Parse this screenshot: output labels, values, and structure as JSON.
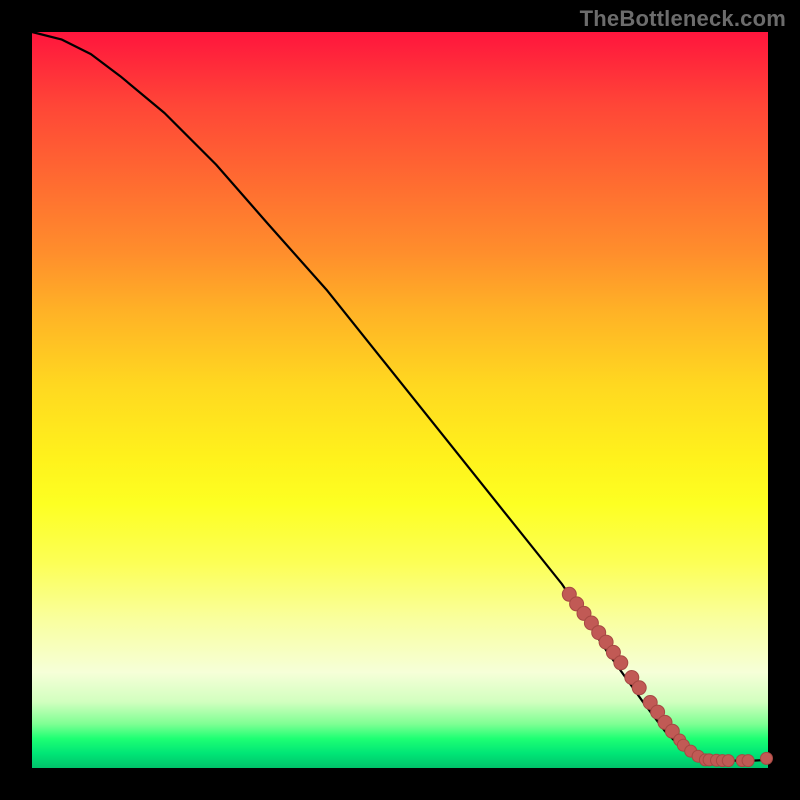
{
  "watermark": "TheBottleneck.com",
  "chart_data": {
    "type": "line",
    "title": "",
    "xlabel": "",
    "ylabel": "",
    "xlim": [
      0,
      100
    ],
    "ylim": [
      0,
      100
    ],
    "series": [
      {
        "name": "bottleneck-curve",
        "x": [
          0,
          4,
          8,
          12,
          18,
          25,
          32,
          40,
          48,
          56,
          64,
          72,
          78,
          83,
          86,
          88,
          90,
          92,
          95,
          98,
          100
        ],
        "y": [
          100,
          99,
          97,
          94,
          89,
          82,
          74,
          65,
          55,
          45,
          35,
          25,
          16,
          9,
          5,
          3,
          1.8,
          1.2,
          1.0,
          1.0,
          1.1
        ]
      }
    ],
    "points": {
      "name": "data-markers",
      "x": [
        73.0,
        74.0,
        75.0,
        76.0,
        77.0,
        78.0,
        79.0,
        80.0,
        81.5,
        82.5,
        84.0,
        85.0,
        86.0,
        87.0,
        88.0,
        88.5,
        89.5,
        90.5,
        91.5,
        92.0,
        93.0,
        93.8,
        94.6,
        96.5,
        97.3,
        99.8
      ],
      "y": [
        23.6,
        22.3,
        21.0,
        19.7,
        18.4,
        17.1,
        15.7,
        14.3,
        12.3,
        10.9,
        8.9,
        7.6,
        6.2,
        5.0,
        3.8,
        3.1,
        2.3,
        1.6,
        1.1,
        1.1,
        1.05,
        1.0,
        1.0,
        1.0,
        1.0,
        1.3
      ],
      "r": [
        7,
        7,
        7,
        7,
        7,
        7,
        7,
        7,
        7,
        7,
        7,
        7,
        7,
        7,
        6,
        6,
        6,
        6,
        6,
        6,
        6,
        6,
        6,
        6,
        6,
        6
      ]
    }
  }
}
